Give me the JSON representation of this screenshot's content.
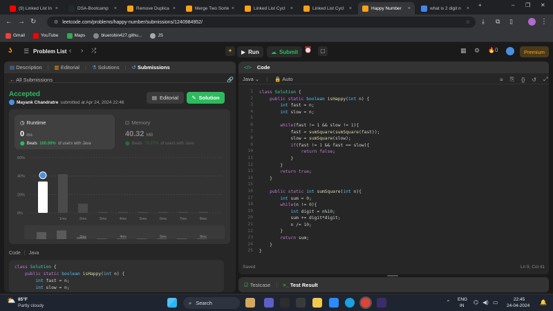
{
  "browser": {
    "tabs": [
      {
        "label": "(9) Linked List In",
        "color": "#ff0000"
      },
      {
        "label": "DSA-Bootcamp",
        "color": "#24292e"
      },
      {
        "label": "Remove Duplica",
        "color": "#ffa116"
      },
      {
        "label": "Merge Two Sorte",
        "color": "#ffa116"
      },
      {
        "label": "Linked List Cycl",
        "color": "#ffa116"
      },
      {
        "label": "Linked List Cycl",
        "color": "#ffa116"
      },
      {
        "label": "Happy Number",
        "color": "#ffa116"
      },
      {
        "label": "what is 2 digit n",
        "color": "#4285f4"
      }
    ],
    "url": "leetcode.com/problems/happy-number/submissions/1240984952/",
    "bookmarks": [
      "Gmail",
      "YouTube",
      "Maps",
      "bluerobin427.githu...",
      "JS"
    ]
  },
  "lc": {
    "problem_list": "Problem List",
    "run": "Run",
    "submit": "Submit",
    "counter": "0",
    "premium": "Premium"
  },
  "left": {
    "tabs": [
      "Description",
      "Editorial",
      "Solutions",
      "Submissions"
    ],
    "all_submissions": "All Submissions",
    "status": "Accepted",
    "user": "Mayank Chandratre",
    "submitted": "submitted at Apr 24, 2024 22:46",
    "editorial_btn": "Editorial",
    "solution_btn": "Solution",
    "runtime": {
      "label": "Runtime",
      "value": "0",
      "unit": "ms",
      "beats_prefix": "Beats",
      "beats": "100.00%",
      "beats_suffix": "of users with Java"
    },
    "memory": {
      "label": "Memory",
      "value": "40.32",
      "unit": "MB",
      "beats_prefix": "Beats",
      "beats": "79.97%",
      "beats_suffix": "of users with Java"
    },
    "code_label": "Code",
    "lang_label": "Java",
    "snippet": [
      "class Solution {",
      "    public static boolean isHappy(int n) {",
      "        int fast = n;",
      "        int slow = n;"
    ]
  },
  "chart_data": {
    "type": "bar",
    "categories": [
      "0ms",
      "1ms",
      "2ms",
      "3ms",
      "4ms",
      "5ms",
      "6ms",
      "7ms",
      "8ms"
    ],
    "values": [
      34,
      42,
      10,
      1,
      1,
      1,
      1,
      1,
      1
    ],
    "ylim": [
      0,
      60
    ],
    "yticks": [
      "60%",
      "40%",
      "20%",
      "0%"
    ],
    "xtick_labels": [
      "",
      "1ms",
      "2ms",
      "3ms",
      "4ms",
      "5ms",
      "6ms",
      "7ms",
      "8ms"
    ],
    "mini_labels": [
      "2ms",
      "4ms",
      "6ms",
      "8ms"
    ],
    "highlight_color": "#ffffff",
    "bar_color": "#4a4a4a"
  },
  "right": {
    "title": "Code",
    "lang": "Java",
    "auto": "Auto",
    "saved": "Saved",
    "cursor": "Ln 9, Col 41",
    "testcase": "Testcase",
    "test_result": "Test Result"
  },
  "code_lines": [
    "class Solution {",
    "    public static boolean isHappy(int n) {",
    "        int fast = n;",
    "        int slow = n;",
    "",
    "        while(fast != 1 && slow != 1){",
    "            fast = sumSquare(sumSquare(fast));",
    "            slow = sumSquare(slow);",
    "            if(fast != 1 && fast == slow){",
    "                return false;",
    "            }",
    "        }",
    "        return true;",
    "    }",
    "",
    "    public static int sumSquare(int n){",
    "        int sum = 0;",
    "        while(n != 0){",
    "            int digit = n%10;",
    "            sum += digit*digit;",
    "            n /= 10;",
    "        }",
    "        return sum;",
    "    }",
    "}"
  ],
  "taskbar": {
    "temp": "85°F",
    "weather": "Partly cloudy",
    "search": "Search",
    "lang": "ENG",
    "region": "IN",
    "time": "22:45",
    "date": "24-04-2024"
  }
}
